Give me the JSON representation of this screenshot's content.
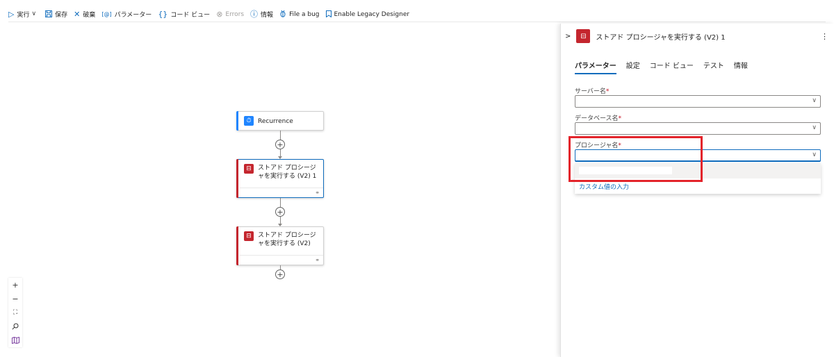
{
  "toolbar": {
    "items": [
      {
        "label": "実行",
        "icon": "play-icon",
        "dropdown": true
      },
      {
        "label": "保存",
        "icon": "save-icon"
      },
      {
        "label": "破棄",
        "icon": "close-icon"
      },
      {
        "label": "パラメーター",
        "icon": "parameters-icon"
      },
      {
        "label": "コード ビュー",
        "icon": "code-braces-icon"
      },
      {
        "label": "Errors",
        "icon": "error-circle-icon",
        "disabled": true
      },
      {
        "label": "情報",
        "icon": "info-icon"
      },
      {
        "label": "File a bug",
        "icon": "bug-icon"
      },
      {
        "label": "Enable Legacy Designer",
        "icon": "bookmark-icon"
      }
    ]
  },
  "canvas": {
    "nodes": {
      "recurrence": {
        "title": "Recurrence",
        "icon": "alarm-clock-icon",
        "color": "#1f85ff"
      },
      "sp1": {
        "title_line1": "ストアド プロシージ",
        "title_line2": "ャを実行する (V2) 1",
        "icon": "sql-server-icon",
        "color": "#c4262e"
      },
      "sp2": {
        "title_line1": "ストアド プロシージ",
        "title_line2": "ャを実行する (V2)",
        "icon": "sql-server-icon",
        "color": "#c4262e"
      }
    },
    "zoom_controls": [
      "zoom-in-icon",
      "zoom-out-icon",
      "fit-view-icon",
      "search-icon",
      "minimap-icon"
    ]
  },
  "panel": {
    "title": "ストアド プロシージャを実行する (V2) 1",
    "tabs": [
      "パラメーター",
      "設定",
      "コード ビュー",
      "テスト",
      "情報"
    ],
    "active_tab": "パラメーター",
    "fields": {
      "server": {
        "label": "サーバー名",
        "required_mark": "*",
        "value": ""
      },
      "database": {
        "label": "データベース名",
        "required_mark": "*",
        "value": ""
      },
      "procedure": {
        "label": "プロシージャ名",
        "required_mark": "*",
        "value": ""
      }
    },
    "dropdown": {
      "custom_value_label": "カスタム値の入力"
    }
  },
  "colors": {
    "accent": "#0f6cbd",
    "sql_red": "#c4262e",
    "recurrence_blue": "#1f85ff",
    "highlight_red": "#e3242b"
  }
}
